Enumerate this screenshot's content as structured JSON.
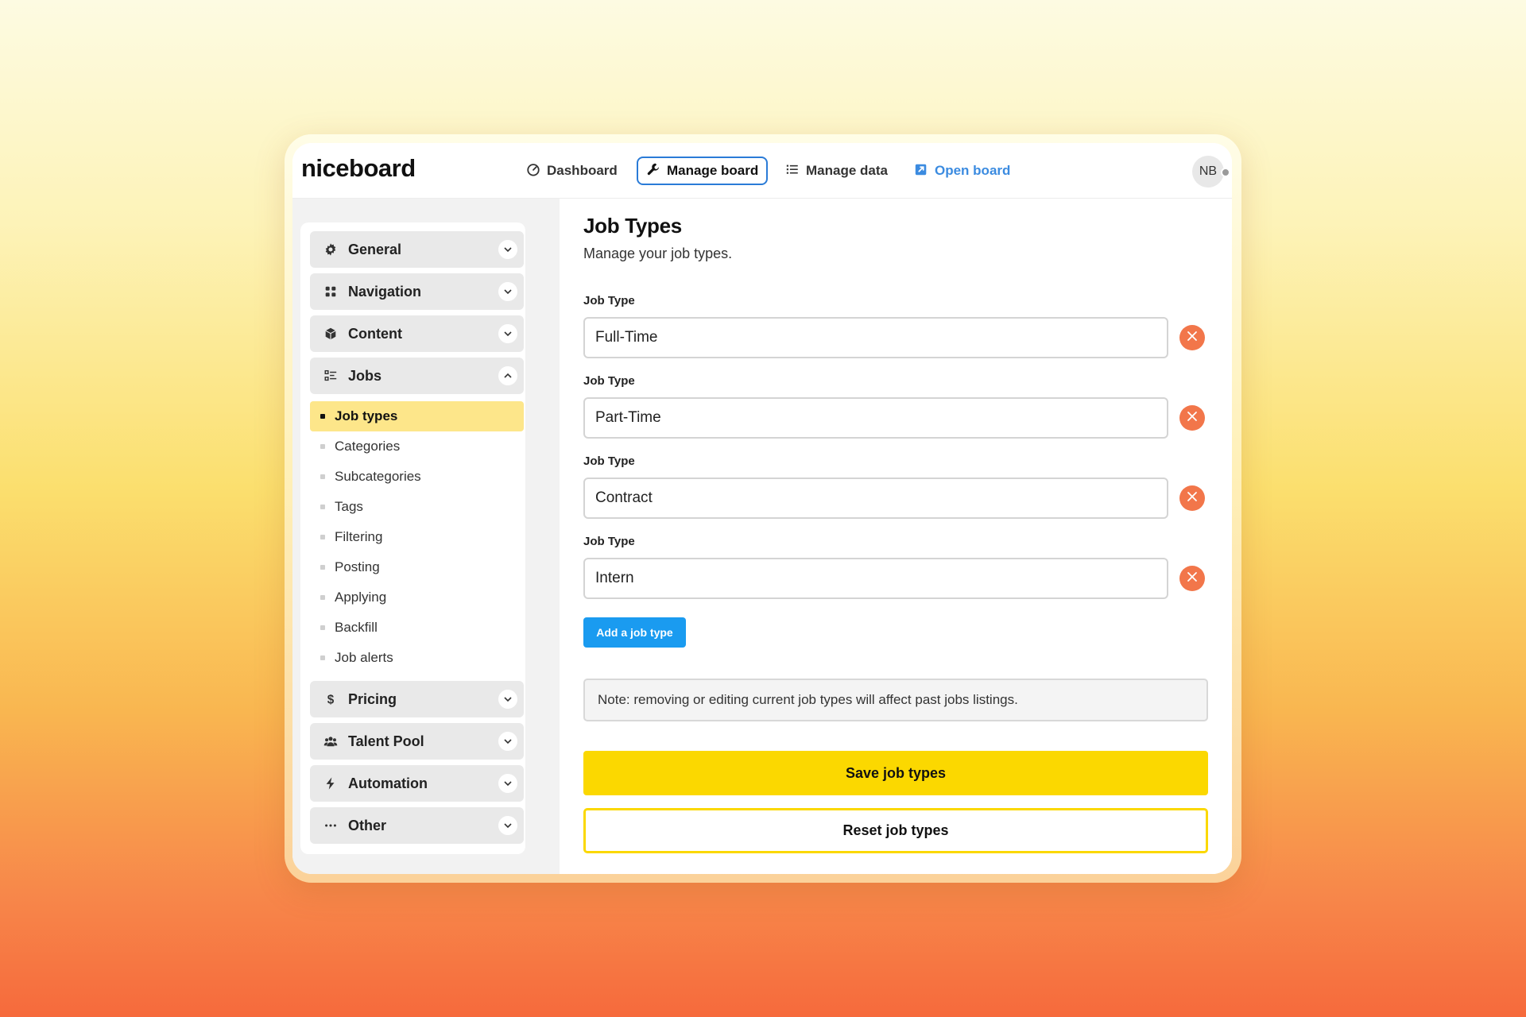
{
  "app": {
    "logo": "niceboard",
    "avatar_initials": "NB"
  },
  "topnav": [
    {
      "label": "Dashboard",
      "icon": "gauge-icon"
    },
    {
      "label": "Manage board",
      "icon": "wrench-icon",
      "active": true
    },
    {
      "label": "Manage data",
      "icon": "list-icon"
    },
    {
      "label": "Open board",
      "icon": "external-link-icon"
    }
  ],
  "sidebar": {
    "sections": [
      {
        "label": "General",
        "icon": "gear-icon",
        "expanded": false
      },
      {
        "label": "Navigation",
        "icon": "grid-icon",
        "expanded": false
      },
      {
        "label": "Content",
        "icon": "cube-icon",
        "expanded": false
      },
      {
        "label": "Jobs",
        "icon": "checklist-icon",
        "expanded": true
      },
      {
        "label": "Pricing",
        "icon": "dollar-icon",
        "expanded": false
      },
      {
        "label": "Talent Pool",
        "icon": "users-icon",
        "expanded": false
      },
      {
        "label": "Automation",
        "icon": "bolt-icon",
        "expanded": false
      },
      {
        "label": "Other",
        "icon": "ellipsis-icon",
        "expanded": false
      }
    ],
    "jobs_items": [
      "Job types",
      "Categories",
      "Subcategories",
      "Tags",
      "Filtering",
      "Posting",
      "Applying",
      "Backfill",
      "Job alerts"
    ],
    "active_item": "Job types"
  },
  "main": {
    "title": "Job Types",
    "subtitle": "Manage your job types.",
    "fields": [
      {
        "label": "Job Type",
        "value": "Full-Time"
      },
      {
        "label": "Job Type",
        "value": "Part-Time"
      },
      {
        "label": "Job Type",
        "value": "Contract"
      },
      {
        "label": "Job Type",
        "value": "Intern"
      }
    ],
    "add_label": "Add a job type",
    "note": "Note: removing or editing current job types will affect past jobs listings.",
    "save_label": "Save job types",
    "reset_label": "Reset job types"
  },
  "colors": {
    "accent_yellow": "#fbd800",
    "active_item_bg": "#fde68a",
    "primary_blue": "#1a9bf0",
    "remove_orange": "#f2764a",
    "link_blue": "#3b8be0"
  }
}
